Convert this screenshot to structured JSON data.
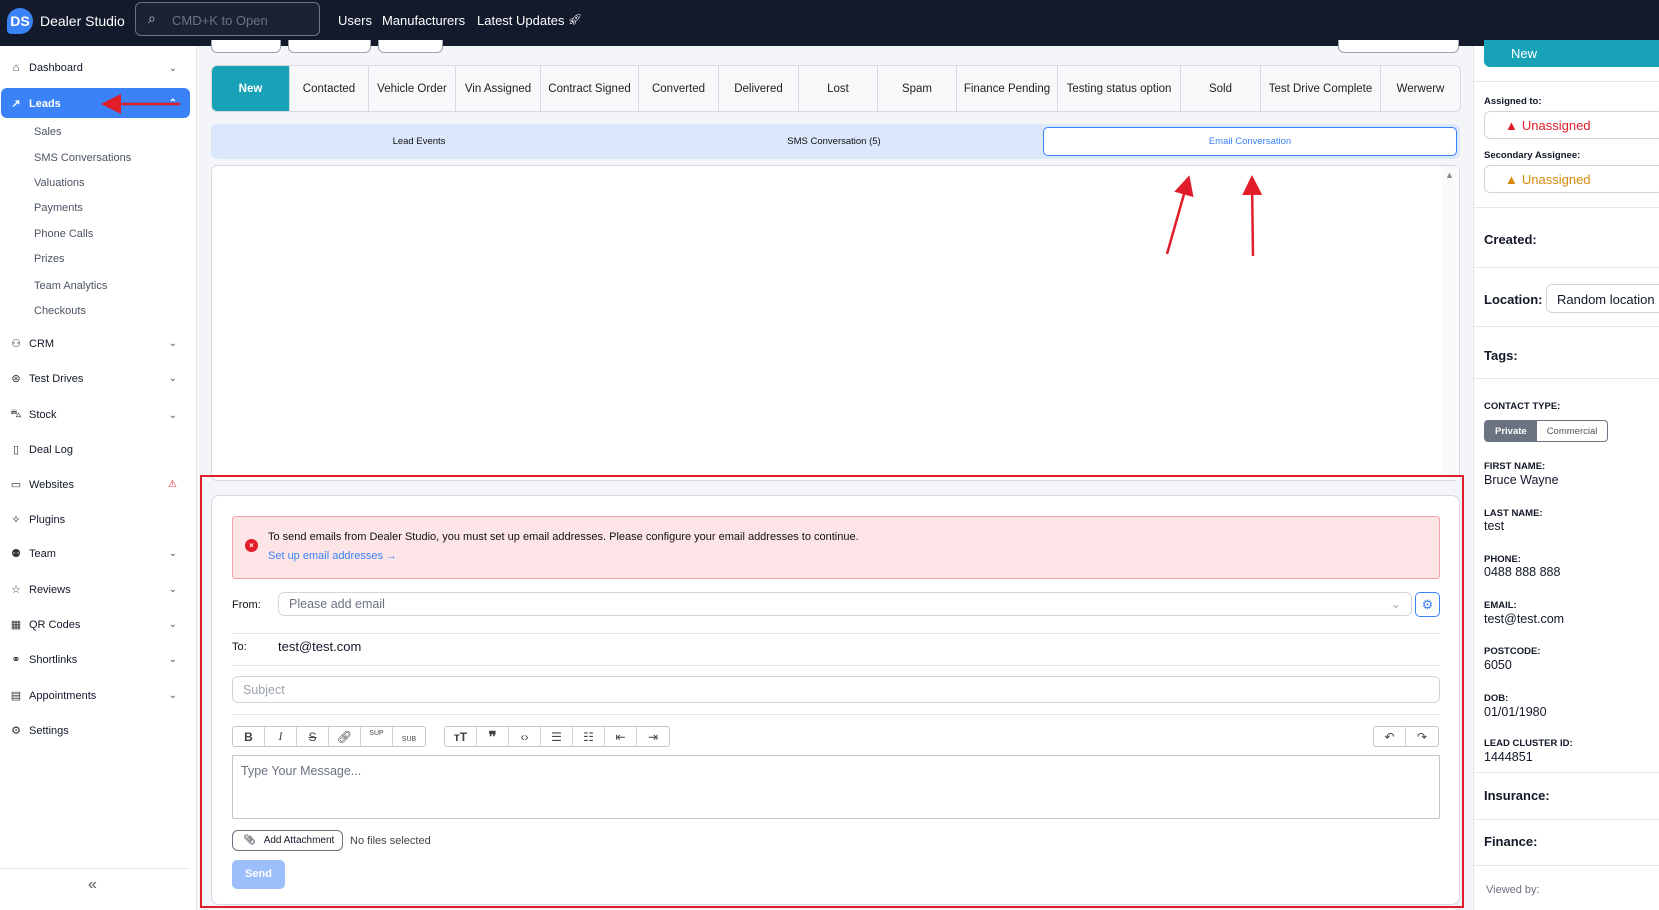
{
  "topbar": {
    "logo": "DS",
    "brand": "Dealer Studio",
    "search_placeholder": "CMD+K to Open",
    "nav": [
      "Users",
      "Manufacturers",
      "Latest Updates"
    ]
  },
  "sidebar": {
    "items": [
      {
        "label": "Dashboard",
        "icon": "home-icon"
      },
      {
        "label": "Leads",
        "icon": "trend-icon"
      },
      {
        "label": "CRM",
        "icon": "users-icon"
      },
      {
        "label": "Test Drives",
        "icon": "steering-icon"
      },
      {
        "label": "Stock",
        "icon": "car-icon"
      },
      {
        "label": "Deal Log",
        "icon": "file-icon"
      },
      {
        "label": "Websites",
        "icon": "monitor-icon"
      },
      {
        "label": "Plugins",
        "icon": "puzzle-icon"
      },
      {
        "label": "Team",
        "icon": "team-icon"
      },
      {
        "label": "Reviews",
        "icon": "star-icon"
      },
      {
        "label": "QR Codes",
        "icon": "qr-icon"
      },
      {
        "label": "Shortlinks",
        "icon": "link-icon"
      },
      {
        "label": "Appointments",
        "icon": "calendar-icon"
      },
      {
        "label": "Settings",
        "icon": "gear-icon"
      }
    ],
    "leads_sub": [
      "Sales",
      "SMS Conversations",
      "Valuations",
      "Payments",
      "Phone Calls",
      "Prizes",
      "Team Analytics",
      "Checkouts"
    ],
    "collapse": "«"
  },
  "status_tabs": [
    "New",
    "Contacted",
    "Vehicle Order",
    "Vin Assigned",
    "Contract Signed",
    "Converted",
    "Delivered",
    "Lost",
    "Spam",
    "Finance Pending",
    "Testing status option",
    "Sold",
    "Test Drive Complete",
    "Werwerw"
  ],
  "sub_tabs": [
    "Lead Events",
    "SMS Conversation (5)",
    "Email Conversation"
  ],
  "compose": {
    "alert_text": "To send emails from Dealer Studio, you must set up email addresses. Please configure your email addresses to continue.",
    "alert_link": "Set up email addresses →",
    "from_label": "From:",
    "from_placeholder": "Please add email",
    "to_label": "To:",
    "to_value": "test@test.com",
    "subject_placeholder": "Subject",
    "message_placeholder": "Type Your Message...",
    "toolbar": {
      "sup": "SUP",
      "sub": "SUB"
    },
    "attach_label": "Add Attachment",
    "no_files": "No files selected",
    "send": "Send"
  },
  "right": {
    "status": "New",
    "assigned_label": "Assigned to:",
    "assigned_value": "Unassigned",
    "secondary_label": "Secondary Assignee:",
    "secondary_value": "Unassigned",
    "created": "Created:",
    "location_label": "Location:",
    "location_value": "Random location",
    "tags": "Tags:",
    "contact_type_label": "CONTACT TYPE:",
    "contact_types": [
      "Private",
      "Commercial"
    ],
    "fields": [
      {
        "label": "FIRST NAME:",
        "value": "Bruce Wayne"
      },
      {
        "label": "LAST NAME:",
        "value": "test"
      },
      {
        "label": "PHONE:",
        "value": "0488 888 888"
      },
      {
        "label": "EMAIL:",
        "value": "test@test.com"
      },
      {
        "label": "POSTCODE:",
        "value": "6050"
      },
      {
        "label": "DOB:",
        "value": "01/01/1980"
      },
      {
        "label": "LEAD CLUSTER ID:",
        "value": "1444851"
      }
    ],
    "insurance": "Insurance:",
    "finance": "Finance:",
    "viewed_by": "Viewed by:"
  },
  "colors": {
    "accent": "#3b82f6",
    "teal": "#17a2b8",
    "annotation": "#e11d2a",
    "topbar": "#121a2b"
  }
}
